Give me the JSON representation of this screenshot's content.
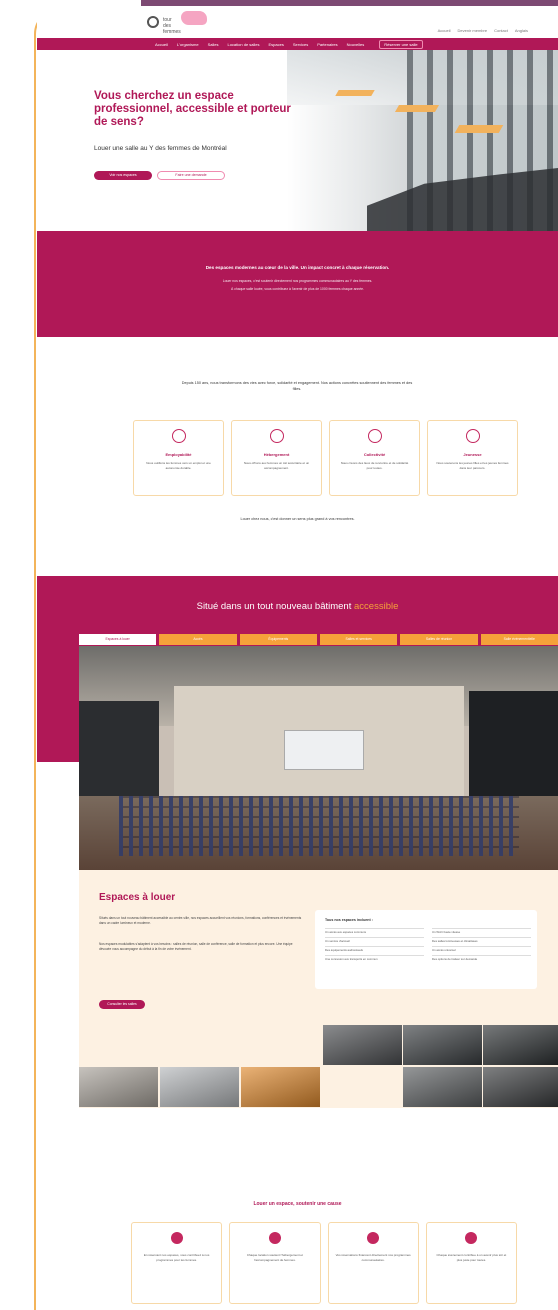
{
  "brand": {
    "logo_small_text": "tour des femmes",
    "colors": {
      "primary": "#b01857",
      "accent": "#f5a13a",
      "cream": "#fdf1e2",
      "border": "#f7d9a8"
    }
  },
  "utility": [
    "Accueil",
    "Devenir membre",
    "Contact",
    "Anglais"
  ],
  "nav": {
    "items": [
      "Accueil",
      "L'organisme",
      "Salles",
      "Location de salles",
      "Espaces",
      "Services",
      "Partenaires",
      "Nouvelles"
    ],
    "cta": "Réserver une salle"
  },
  "hero": {
    "title": "Vous cherchez un espace professionnel, accessible et porteur de sens?",
    "subtitle": "Louer une salle au Y des femmes de Montréal",
    "btn_primary": "Voir nos espaces",
    "btn_secondary": "Faire une demande"
  },
  "band1": {
    "headline": "Des espaces modernes au cœur de la ville. Un impact concret à chaque réservation.",
    "line1": "Louer nos espaces, c'est soutenir directement nos programmes communautaires au Y des femmes.",
    "line2": "À chaque salle louée, vous contribuez à l'avenir de plus de 1000 femmes chaque année."
  },
  "features": {
    "intro": "Depuis 150 ans, nous transformons des vies avec force, solidarité et engagement. Nos actions concrètes soutiennent des femmes et des filles.",
    "cards": [
      {
        "icon": "employability-icon",
        "title": "Employabilité",
        "desc": "Nous outillons les femmes vers un emploi et une autonomie durable."
      },
      {
        "icon": "housing-icon",
        "title": "Hébergement",
        "desc": "Nous offrons aux femmes un toit sécuritaire et un accompagnement."
      },
      {
        "icon": "community-icon",
        "title": "Collectivité",
        "desc": "Nous créons des lieux de rencontre et de solidarité pour toutes."
      },
      {
        "icon": "youth-icon",
        "title": "Jeunesse",
        "desc": "Nous soutenons les jeunes filles et les jeunes femmes dans leur parcours."
      }
    ],
    "loue": "Louer chez nous, c'est donner un sens plus grand à vos rencontres."
  },
  "accessible": {
    "heading_pre": "Situé dans un tout nouveau bâtiment",
    "heading_accent": "accessible",
    "tabs": [
      "Espaces à louer",
      "Accès",
      "Équipements",
      "Salles et services",
      "Salles de réunion",
      "Salle événementielle"
    ]
  },
  "espaces": {
    "title": "Espaces à louer",
    "p1": "Situés dans un tout nouveau bâtiment accessible au centre-ville, nos espaces accueillent vos réunions, formations, conférences et événements dans un cadre lumineux et moderne.",
    "p2": "Nos espaces modulables s'adaptent à vos besoins : salles de réunion, salle de conférence, salle de formation et plus encore. Une équipe dévouée vous accompagne du début à la fin de votre événement.",
    "button": "Consulter les salles",
    "list_title": "Tous nos espaces incluent :",
    "list": [
      "Un accès aux espaces communs",
      "Un Wi-Fi haute vitesse",
      "Un service d'accueil",
      "Des salles lumineuses et climatisées",
      "Des équipements audiovisuels",
      "Un accès universel",
      "Une connexion aux transports en commun",
      "Des options de traiteur sur demande"
    ]
  },
  "cause": {
    "title": "Louer un espace, soutenir une cause",
    "cards": [
      "En réservant nos espaces, vous contribuez à nos programmes pour les femmes.",
      "Chaque location soutient l'hébergement et l'accompagnement de femmes.",
      "Vos réservations financent directement nos programmes communautaires.",
      "Chaque événement contribue à un avenir plus sûr et plus juste pour toutes."
    ]
  }
}
